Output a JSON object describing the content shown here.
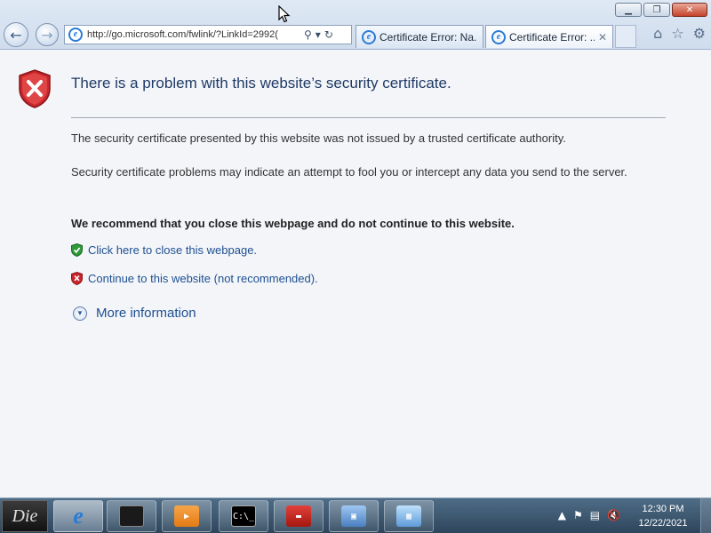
{
  "browser": {
    "address_url": "http://go.microsoft.com/fwlink/?LinkId=2992(",
    "tabs": [
      {
        "label": "Certificate Error: Na..."
      },
      {
        "label": "Certificate Error: ..."
      }
    ],
    "window_controls": {
      "minimize_icon": "minimize-icon",
      "restore_icon": "restore-icon",
      "close_icon": "close-icon"
    }
  },
  "page": {
    "heading": "There is a problem with this website’s security certificate.",
    "para1": "The security certificate presented by this website was not issued by a trusted certificate authority.",
    "para2": "Security certificate problems may indicate an attempt to fool you or intercept any data you send to the server.",
    "recommendation": "We recommend that you close this webpage and do not continue to this website.",
    "close_link": "Click here to close this webpage.",
    "continue_link": "Continue to this website (not recommended).",
    "more_info": "More information"
  },
  "taskbar": {
    "start_label": "Die",
    "cmd_glyph": "C:\\_",
    "clock_time": "12:30 PM",
    "clock_date": "12/22/2021"
  },
  "colors": {
    "heading": "#1f3a66",
    "link": "#1e4f91",
    "danger_shield": "#c8262c",
    "safe_shield": "#2f9a3a"
  }
}
